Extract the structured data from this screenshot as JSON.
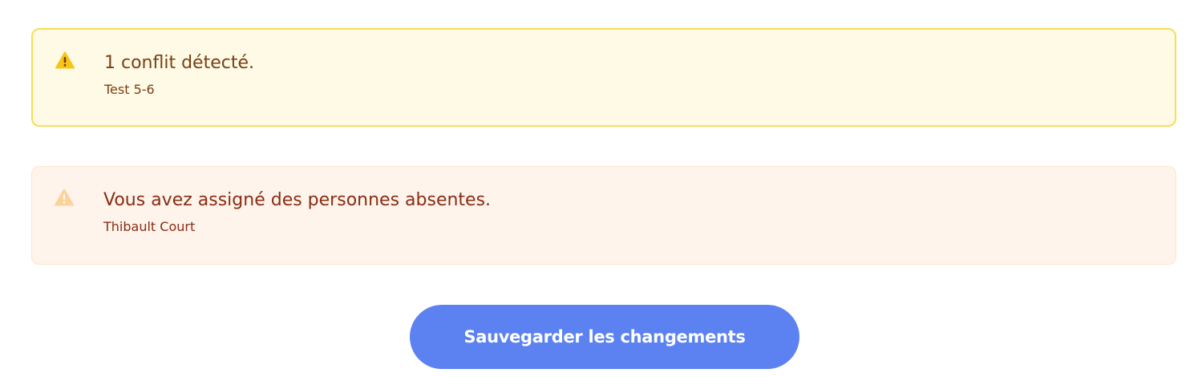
{
  "alerts": {
    "conflict": {
      "title": "1 conflit détecté.",
      "detail": "Test 5-6",
      "icon": "warning-triangle-icon",
      "icon_color": "#f6c518"
    },
    "absent": {
      "title": "Vous avez assigné des personnes absentes.",
      "detail": "Thibault Court",
      "icon": "warning-triangle-icon",
      "icon_color": "#fcd29b"
    }
  },
  "actions": {
    "save_label": "Sauvegarder les changements",
    "save_color": "#5b82f0"
  }
}
